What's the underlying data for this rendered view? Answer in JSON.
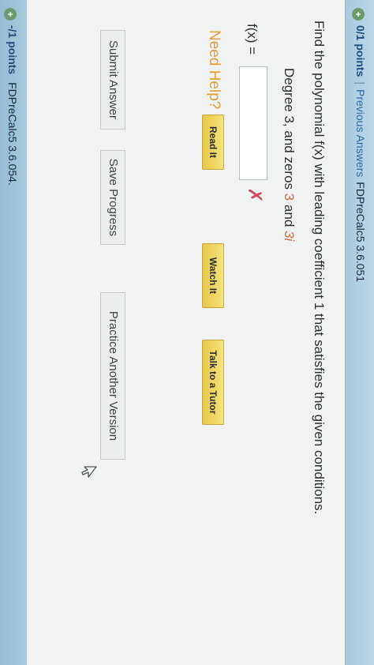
{
  "header": {
    "points": "0/1 points",
    "separator": "|",
    "previous_answers": "Previous Answers",
    "problem_code": "FDPreCalc5 3.6.051"
  },
  "question": {
    "prompt": "Find the polynomial f(x) with leading coefficient 1 that satisfies the given conditions.",
    "condition_prefix": "Degree 3, and zeros",
    "zero_1": "3",
    "and_word": "and",
    "zero_2": "3i"
  },
  "answer": {
    "label": "f(x) =",
    "value": "",
    "status_mark": "✗"
  },
  "help": {
    "title": "Need Help?",
    "read_it": "Read It",
    "watch_it": "Watch It",
    "talk_to_tutor": "Talk to a Tutor"
  },
  "actions": {
    "submit": "Submit Answer",
    "save": "Save Progress",
    "practice": "Practice Another Version"
  },
  "next_question": {
    "points": "-/1 points",
    "problem_code": "FDPreCalc5 3.6.054."
  },
  "colors": {
    "header_bg": "#a9c9dd",
    "zero_highlight": "#d4683e",
    "need_help": "#e79d36",
    "help_button": "#e6c84b",
    "wrong_mark": "#d0495a"
  },
  "icons": {
    "header_badge": "plus-circle-icon",
    "status": "x-mark-icon",
    "cursor": "pointer-cursor-icon"
  }
}
